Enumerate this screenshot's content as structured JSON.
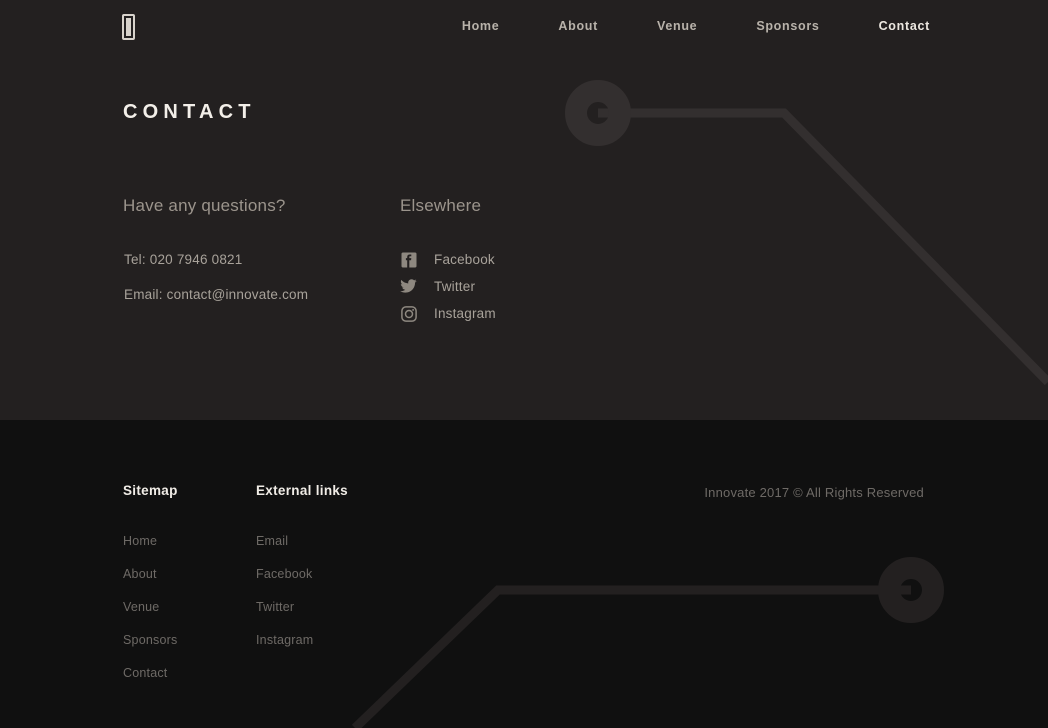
{
  "theme": {
    "upper_bg": "#232020",
    "footer_bg": "#101010",
    "deco_line": "#332f2f",
    "deco_line_footer": "#232020",
    "heading_color": "#f3efe9",
    "muted_text": "#a8a29a",
    "dim_text": "#6e6a66",
    "nav_color": "#b8b2aa",
    "nav_active_color": "#ece7e0"
  },
  "header": {
    "logo_name": "innovate-logo",
    "nav": [
      {
        "label": "Home",
        "active": false
      },
      {
        "label": "About",
        "active": false
      },
      {
        "label": "Venue",
        "active": false
      },
      {
        "label": "Sponsors",
        "active": false
      },
      {
        "label": "Contact",
        "active": true
      }
    ]
  },
  "main": {
    "page_title": "CONTACT",
    "questions": {
      "heading": "Have any questions?",
      "tel": "Tel: 020 7946 0821",
      "email": "Email: contact@innovate.com"
    },
    "elsewhere": {
      "heading": "Elsewhere",
      "socials": [
        {
          "label": "Facebook",
          "icon": "facebook-icon"
        },
        {
          "label": "Twitter",
          "icon": "twitter-icon"
        },
        {
          "label": "Instagram",
          "icon": "instagram-icon"
        }
      ]
    }
  },
  "footer": {
    "sitemap": {
      "heading": "Sitemap",
      "links": [
        "Home",
        "About",
        "Venue",
        "Sponsors",
        "Contact"
      ]
    },
    "external": {
      "heading": "External links",
      "links": [
        "Email",
        "Facebook",
        "Twitter",
        "Instagram"
      ]
    },
    "copyright": "Innovate 2017 © All Rights Reserved"
  }
}
